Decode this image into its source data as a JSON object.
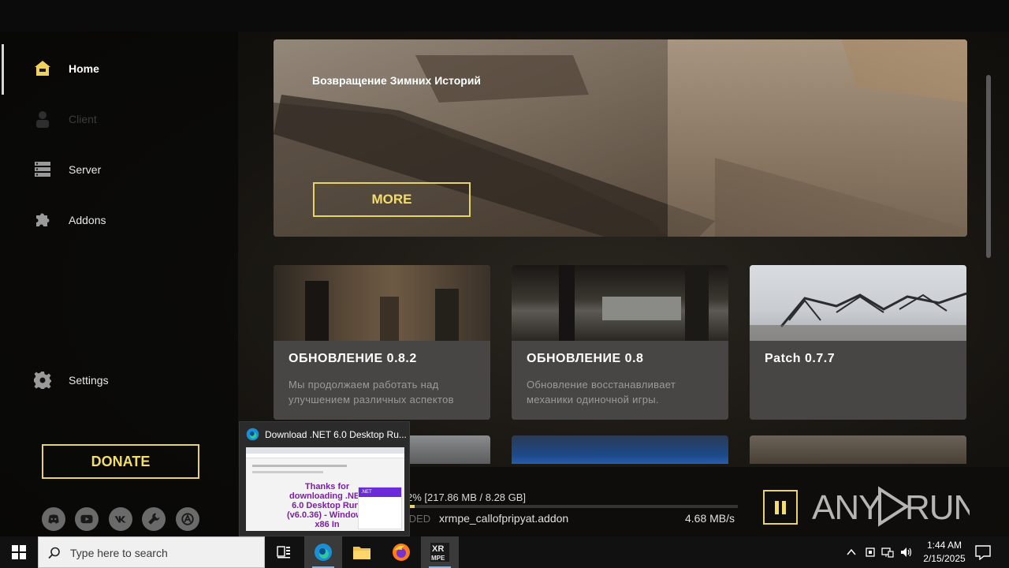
{
  "sidebar": {
    "items": [
      {
        "label": "Home",
        "icon": "home-icon",
        "state": "active"
      },
      {
        "label": "Client",
        "icon": "client-icon",
        "state": "disabled"
      },
      {
        "label": "Server",
        "icon": "server-icon",
        "state": "normal"
      },
      {
        "label": "Addons",
        "icon": "puzzle-icon",
        "state": "normal"
      }
    ],
    "settings_label": "Settings",
    "donate_label": "DONATE",
    "socials": [
      "discord-icon",
      "youtube-icon",
      "vk-icon",
      "wrench-icon",
      "anomaly-icon"
    ]
  },
  "hero": {
    "title": "Возвращение Зимних Историй",
    "more_label": "MORE"
  },
  "news": [
    {
      "title": "ОБНОВЛЕНИЕ 0.8.2",
      "desc": "Мы продолжаем работать над улучшением различных аспектов"
    },
    {
      "title": "ОБНОВЛЕНИЕ 0.8",
      "desc": "Обновление восстанавливает механики одиночной игры."
    },
    {
      "title": "Patch 0.7.7",
      "desc": ""
    }
  ],
  "download": {
    "progress_text": "2%  [217.86 MB / 8.28 GB]",
    "progress_fraction": 0.02,
    "state_label": "ADED",
    "file": "xrmpe_callofpripyat.addon",
    "speed": "4.68 MB/s"
  },
  "watermark": "ANY RUN",
  "popup": {
    "title": "Download .NET 6.0 Desktop Ru...",
    "thumb_heading": "Thanks for downloading .NET 6.0 Desktop Runt (v6.0.36) - Windows x86 In",
    "thumb_side_header": ".NET"
  },
  "taskbar": {
    "search_placeholder": "Type here to search",
    "apps": [
      "task-view-icon",
      "edge-icon",
      "file-explorer-icon",
      "firefox-icon",
      "xrmpe-launcher-icon"
    ],
    "xrmpe_label": "XR MPE",
    "time": "1:44 AM",
    "date": "2/15/2025"
  },
  "colors": {
    "accent": "#e8d36a",
    "sidebar_bg": "#080807",
    "card_bg": "#484745",
    "taskbar_bg": "#111111"
  }
}
